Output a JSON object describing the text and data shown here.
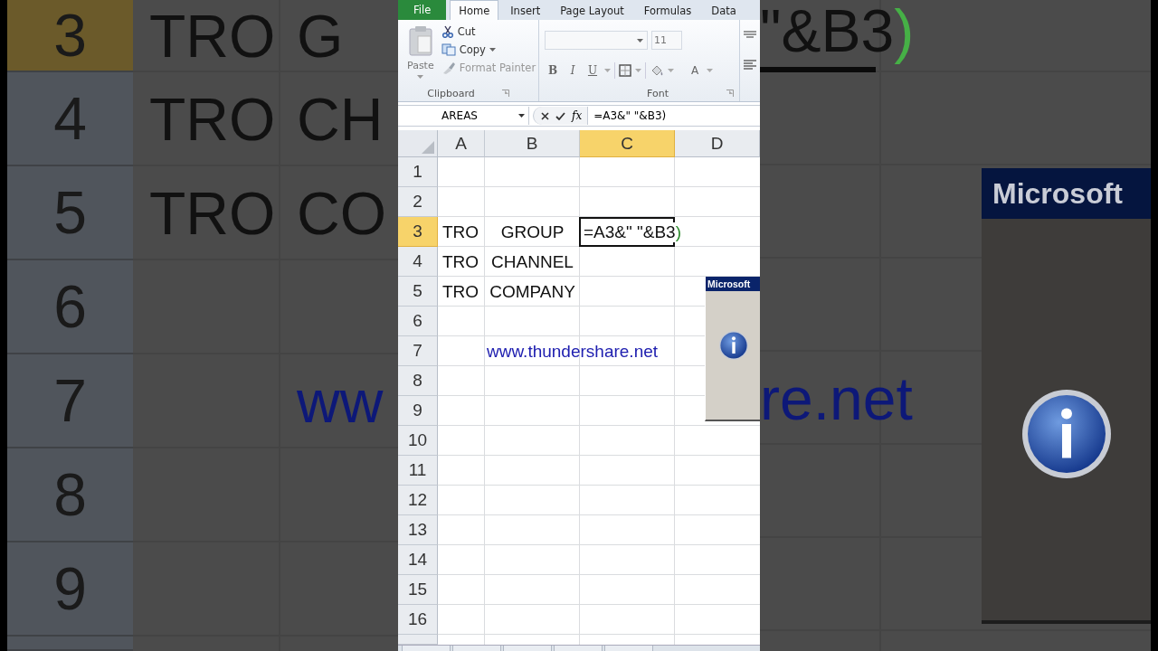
{
  "backdrop_left": {
    "rows": [
      {
        "label": "3",
        "selected": true,
        "A": "TRO",
        "B": "G"
      },
      {
        "label": "4",
        "selected": false,
        "A": "TRO",
        "B": "CH"
      },
      {
        "label": "5",
        "selected": false,
        "A": "TRO",
        "B": "CO"
      },
      {
        "label": "6",
        "selected": false
      },
      {
        "label": "7",
        "selected": false,
        "link": "ww"
      },
      {
        "label": "8",
        "selected": false
      },
      {
        "label": "9",
        "selected": false
      }
    ]
  },
  "ribbon": {
    "tabs": [
      {
        "label": "File",
        "kind": "file",
        "selected": false
      },
      {
        "label": "Home",
        "kind": "tab",
        "selected": true
      },
      {
        "label": "Insert",
        "kind": "tab",
        "selected": false
      },
      {
        "label": "Page Layout",
        "kind": "tab",
        "selected": false
      },
      {
        "label": "Formulas",
        "kind": "tab",
        "selected": false
      },
      {
        "label": "Data",
        "kind": "tab",
        "selected": false
      }
    ],
    "clipboard": {
      "paste": "Paste",
      "cut": "Cut",
      "copy": "Copy",
      "format_painter": "Format Painter",
      "group_label": "Clipboard"
    },
    "font": {
      "size": "11",
      "format_buttons": [
        "B",
        "I",
        "U"
      ],
      "font_color": "A",
      "group_label": "Font"
    }
  },
  "formula_bar": {
    "name_box": "AREAS",
    "function_label": "fx",
    "formula": "=A3&\" \"&B3)"
  },
  "sheet": {
    "columns": [
      {
        "label": "A",
        "selected": false
      },
      {
        "label": "B",
        "selected": false
      },
      {
        "label": "C",
        "selected": true
      },
      {
        "label": "D",
        "selected": false
      }
    ],
    "rows": [
      {
        "label": "1",
        "selected": false
      },
      {
        "label": "2",
        "selected": false
      },
      {
        "label": "3",
        "selected": true,
        "A": "TRO",
        "B": "GROUP",
        "editing": {
          "text": "=A3&\" \"&B3",
          "tail": ")"
        }
      },
      {
        "label": "4",
        "selected": false,
        "A": "TRO",
        "B": "CHANNEL"
      },
      {
        "label": "5",
        "selected": false,
        "A": "TRO",
        "B": "COMPANY"
      },
      {
        "label": "6",
        "selected": false
      },
      {
        "label": "7",
        "selected": false,
        "link": "www.thundershare.net"
      },
      {
        "label": "8",
        "selected": false
      },
      {
        "label": "9",
        "selected": false
      },
      {
        "label": "10",
        "selected": false
      },
      {
        "label": "11",
        "selected": false
      },
      {
        "label": "12",
        "selected": false
      },
      {
        "label": "13",
        "selected": false
      },
      {
        "label": "14",
        "selected": false
      },
      {
        "label": "15",
        "selected": false
      },
      {
        "label": "16",
        "selected": false
      }
    ]
  },
  "dialog": {
    "title": "Microsoft"
  },
  "backdrop_right": {
    "formula_fragment": "\"&B3",
    "formula_tail": ")",
    "link_fragment": "re.net",
    "dialog_title": "Microsoft"
  }
}
